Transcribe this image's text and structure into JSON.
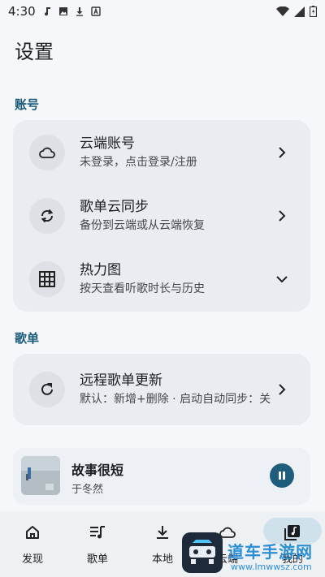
{
  "status_bar": {
    "time": "4:30"
  },
  "page": {
    "title": "设置"
  },
  "sections": {
    "account": {
      "label": "账号",
      "items": [
        {
          "title": "云端账号",
          "subtitle": "未登录，点击登录/注册",
          "icon": "cloud-icon",
          "action": "chevron-right"
        },
        {
          "title": "歌单云同步",
          "subtitle": "备份到云端或从云端恢复",
          "icon": "sync-icon",
          "action": "chevron-right"
        },
        {
          "title": "热力图",
          "subtitle": "按天查看听歌时长与历史",
          "icon": "grid-icon",
          "action": "chevron-down"
        }
      ]
    },
    "playlist": {
      "label": "歌单",
      "items": [
        {
          "title": "远程歌单更新",
          "subtitle": "默认：新增+删除 · 启动自动同步：关",
          "icon": "refresh-icon",
          "action": "chevron-right"
        }
      ]
    }
  },
  "player": {
    "song": "故事很短",
    "artist": "于冬然",
    "state": "playing"
  },
  "bottom_nav": {
    "items": [
      {
        "label": "发现",
        "icon": "home-icon"
      },
      {
        "label": "歌单",
        "icon": "playlist-icon"
      },
      {
        "label": "本地",
        "icon": "download-icon"
      },
      {
        "label": "云端",
        "icon": "cloud-icon"
      },
      {
        "label": "我的",
        "icon": "library-icon",
        "active": true
      }
    ]
  },
  "watermark": {
    "title": "道车手游网",
    "url": "www.lmwwsz.com"
  },
  "colors": {
    "accent": "#1f5d7d",
    "section_label": "#1a5a7a",
    "card_bg": "#e9ecf0",
    "page_bg": "#f5f7fa"
  }
}
